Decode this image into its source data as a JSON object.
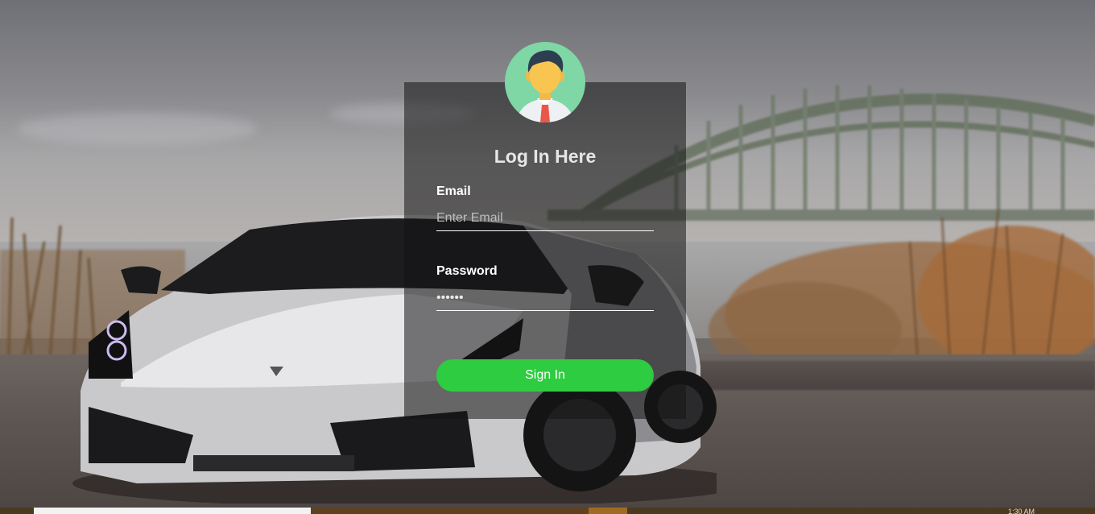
{
  "login": {
    "title": "Log In Here",
    "email_label": "Email",
    "email_placeholder": "Enter Email",
    "password_label": "Password",
    "password_value": "••••••",
    "signin_label": "Sign In"
  },
  "taskbar": {
    "clock": "1:30 AM"
  },
  "colors": {
    "button": "#2ecc40",
    "avatar_bg": "#7fd7a6",
    "card_overlay": "rgba(20,20,20,0.55)"
  },
  "icons": {
    "avatar": "user-avatar-icon"
  }
}
